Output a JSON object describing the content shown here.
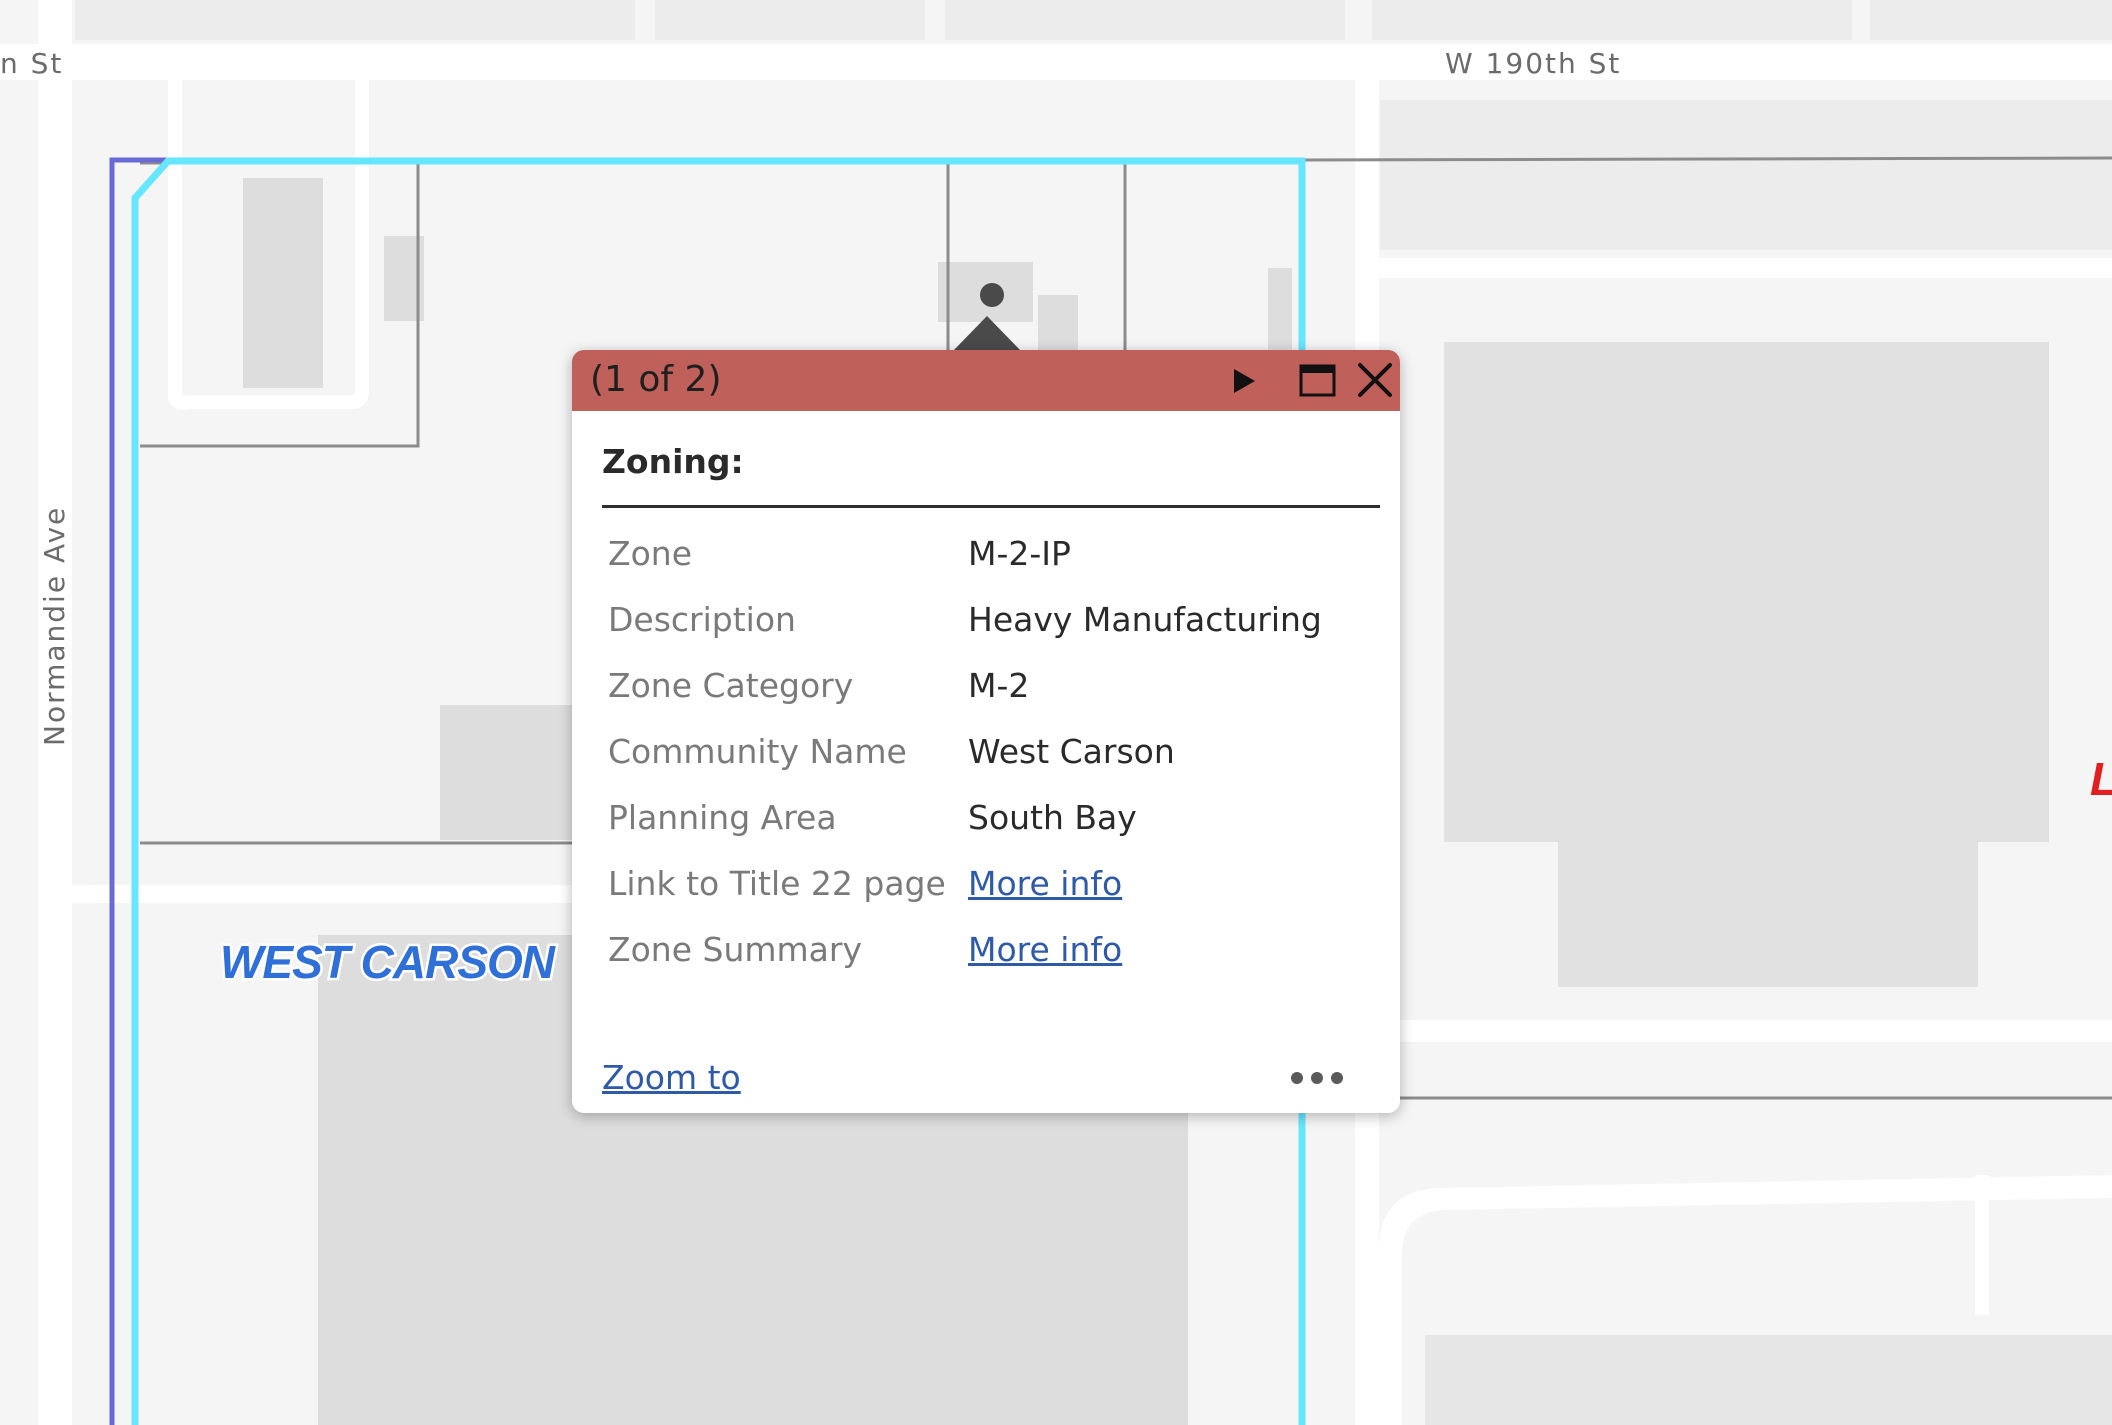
{
  "map": {
    "street_labels": {
      "top_left_fragment": "n St",
      "top_right": "W 190th St",
      "vertical_left": "Normandie Ave"
    },
    "community_label": "WEST CARSON",
    "edge_label_fragment": "L",
    "colors": {
      "background": "#f5f5f5",
      "road": "#ffffff",
      "building": "#e1e1e1",
      "parcel_line": "#8c8c8c",
      "zone_boundary_outer": "#6a6ad6",
      "zone_boundary_selected": "#66e6ff",
      "community_label": "#2f6fd8"
    }
  },
  "popup": {
    "count_text": "(1 of 2)",
    "header_color": "#c0605a",
    "icons": {
      "next": "play-next-icon",
      "maximize": "maximize-icon",
      "close": "close-icon",
      "more": "more-dots-icon"
    },
    "title": "Zoning:",
    "attributes": [
      {
        "label": "Zone",
        "value": "M-2-IP"
      },
      {
        "label": "Description",
        "value": "Heavy Manufacturing"
      },
      {
        "label": "Zone Category",
        "value": "M-2"
      },
      {
        "label": "Community Name",
        "value": "West Carson"
      },
      {
        "label": "Planning Area",
        "value": "South Bay"
      },
      {
        "label": "Link to Title 22 page",
        "value": "More info"
      },
      {
        "label": "Zone Summary",
        "value": "More info"
      }
    ],
    "zoom_to_label": "Zoom to"
  }
}
